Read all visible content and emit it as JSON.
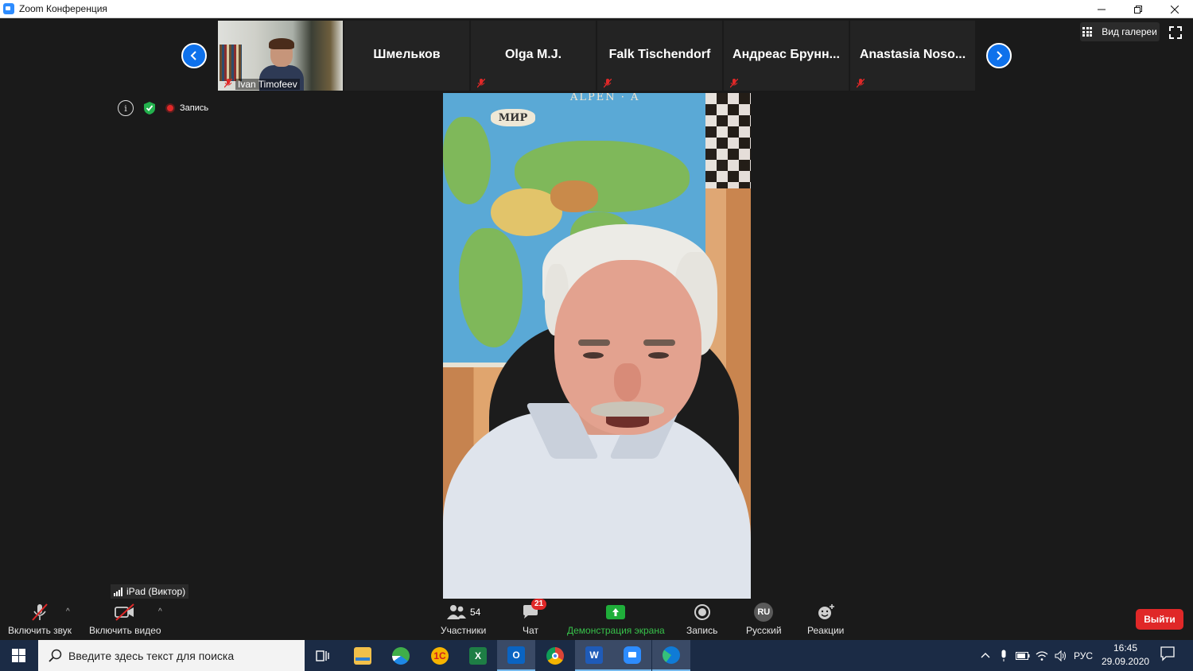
{
  "window": {
    "title": "Zoom Конференция",
    "controls": [
      "minimize-icon",
      "restore-icon",
      "close-icon"
    ]
  },
  "gallery": {
    "participants": [
      {
        "name": "Ivan Timofeev",
        "has_video": true,
        "muted": true
      },
      {
        "name": "Шмельков",
        "has_video": false,
        "muted": false
      },
      {
        "name": "Olga M.J.",
        "has_video": false,
        "muted": true
      },
      {
        "name": "Falk Tischendorf",
        "has_video": false,
        "muted": true
      },
      {
        "name": "Андреас Брунн...",
        "has_video": false,
        "muted": true
      },
      {
        "name": "Anastasia Noso...",
        "has_video": false,
        "muted": true
      }
    ]
  },
  "view": {
    "gallery_label": "Вид галереи"
  },
  "meeting_status": {
    "recording_label": "Запись"
  },
  "speaker_video": {
    "map_title": "МИР",
    "map_header": "ALPEN · A"
  },
  "device_tip": {
    "label": "iPad (Виктор)"
  },
  "toolbar": {
    "unmute_label": "Включить звук",
    "start_video_label": "Включить видео",
    "participants_label": "Участники",
    "participants_count": "54",
    "chat_label": "Чат",
    "chat_badge": "21",
    "share_label": "Демонстрация экрана",
    "record_label": "Запись",
    "language_label": "Русский",
    "language_code": "RU",
    "reactions_label": "Реакции",
    "leave_label": "Выйти"
  },
  "colors": {
    "accent": "#0e71eb",
    "share": "#1fae3a",
    "danger": "#e02828",
    "taskbar": "#1b2b45"
  },
  "taskbar": {
    "search_placeholder": "Введите здесь текст для поиска",
    "apps": [
      "task-view-icon",
      "file-explorer-icon",
      "browser-icon",
      "yandex-icon",
      "excel-icon",
      "outlook-icon",
      "chrome-icon",
      "word-icon",
      "zoom-icon",
      "edge-icon"
    ],
    "tray": {
      "language": "РУС",
      "time": "16:45",
      "date": "29.09.2020"
    }
  }
}
